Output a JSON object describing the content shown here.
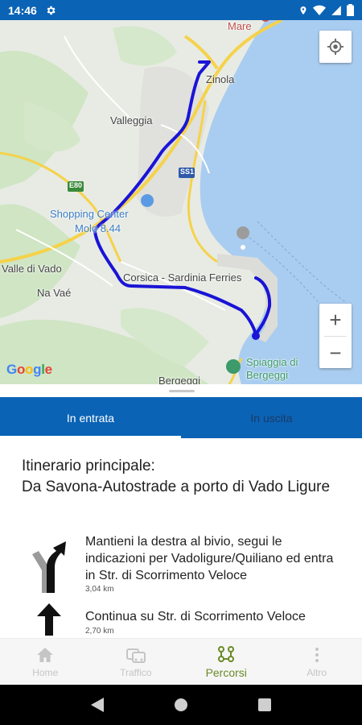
{
  "status_bar": {
    "time": "14:46"
  },
  "map": {
    "labels": {
      "mare": "Mare",
      "zinola": "Zinola",
      "valleggia": "Valleggia",
      "e80": "E80",
      "ss1": "SS1",
      "shopping_center": "Shopping Center",
      "molo": "Molo 8.44",
      "valle_di_vado": "Valle di Vado",
      "na_vae": "Na Vaé",
      "corsica_ferries": "Corsica - Sardinia Ferries",
      "spiaggia": "Spiaggia di",
      "bergeggi": "Bergeggi",
      "bergeggi_bottom": "Bergeggi"
    },
    "attribution": "Google",
    "zoom_in": "+",
    "zoom_out": "−",
    "route_color": "#1a14d6"
  },
  "tabs": [
    {
      "label": "In entrata",
      "active": true
    },
    {
      "label": "In uscita",
      "active": false
    }
  ],
  "route": {
    "title_line1": "Itinerario principale:",
    "title_line2": "Da Savona-Autostrade a porto di Vado Ligure"
  },
  "steps": [
    {
      "icon": "keep-right-arrow-icon",
      "text": "Mantieni la destra al bivio, segui le indicazioni per Vadoligure/Quiliano ed entra in Str. di Scorrimento Veloce",
      "distance": "3,04 km"
    },
    {
      "icon": "straight-arrow-icon",
      "text": "Continua su Str. di Scorrimento Veloce",
      "distance": "2,70 km"
    }
  ],
  "bottom_nav": [
    {
      "label": "Home",
      "icon": "home-icon",
      "active": false
    },
    {
      "label": "Traffico",
      "icon": "traffic-icon",
      "active": false
    },
    {
      "label": "Percorsi",
      "icon": "routes-icon",
      "active": true
    },
    {
      "label": "Altro",
      "icon": "more-icon",
      "active": false
    }
  ],
  "colors": {
    "primary": "#0a63b5",
    "active_nav": "#6b8a27",
    "inactive_nav": "#c5c5c5"
  }
}
